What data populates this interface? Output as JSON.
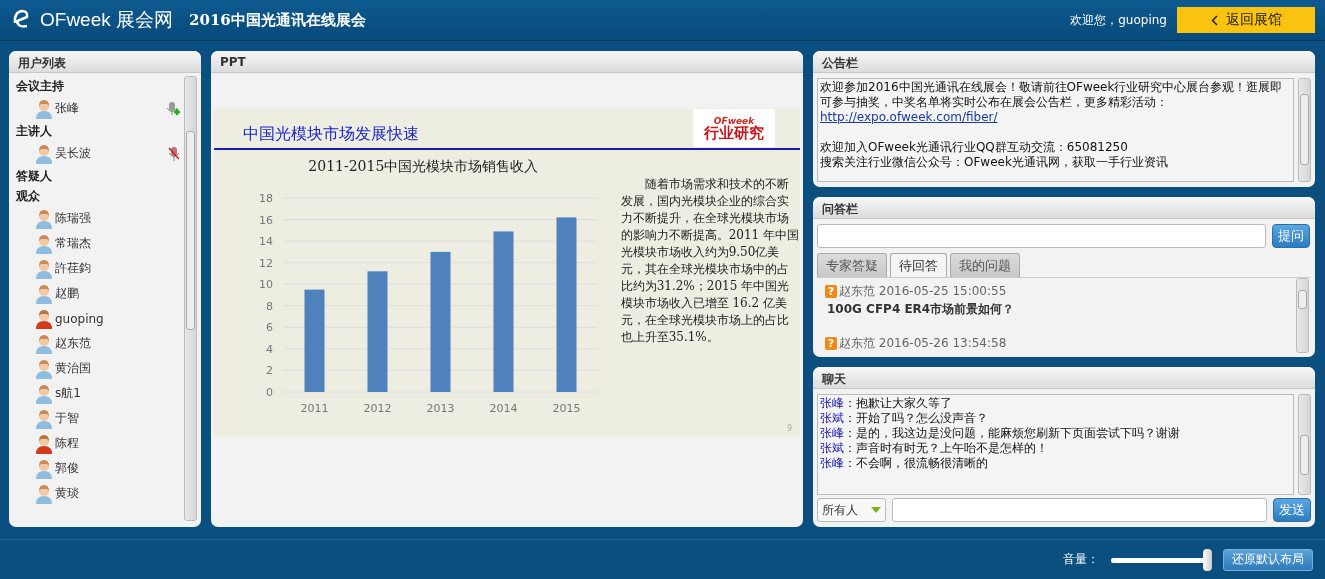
{
  "header": {
    "brand": "OFweek 展会网",
    "title": "2016中国光通讯在线展会",
    "welcome": "欢迎您，guoping",
    "back_button": "返回展馆"
  },
  "user_list": {
    "title": "用户列表",
    "groups": [
      {
        "name": "会议主持",
        "users": [
          {
            "name": "张峰",
            "kind": "blue",
            "mic": {
              "kind": "add"
            }
          }
        ]
      },
      {
        "name": "主讲人",
        "users": [
          {
            "name": "吴长波",
            "kind": "blue",
            "mic": {
              "kind": "muted"
            }
          }
        ]
      },
      {
        "name": "答疑人"
      },
      {
        "name": "观众",
        "users": [
          {
            "name": "陈瑞强",
            "kind": "blue"
          },
          {
            "name": "常瑞杰",
            "kind": "blue"
          },
          {
            "name": "許荏鈞",
            "kind": "blue"
          },
          {
            "name": "赵鹏",
            "kind": "blue"
          },
          {
            "name": "guoping",
            "kind": "red"
          },
          {
            "name": "赵东范",
            "kind": "blue"
          },
          {
            "name": "黄治国",
            "kind": "blue"
          },
          {
            "name": "s航1",
            "kind": "blue"
          },
          {
            "name": "于智",
            "kind": "blue"
          },
          {
            "name": "陈程",
            "kind": "red"
          },
          {
            "name": "郭俊",
            "kind": "blue"
          },
          {
            "name": "黄琰",
            "kind": "blue"
          }
        ]
      }
    ]
  },
  "ppt": {
    "title": "PPT",
    "slide": {
      "heading": "中国光模块市场发展快速",
      "logo_brand": "OFweek",
      "logo_text": "行业研究",
      "body": "随着市场需求和技术的不断发展，国内光模块企业的综合实力不断提升，在全球光模块市场的影响力不断提高。2011 年中国光模块市场收入约为9.50亿美元，其在全球光模块市场中的占比约为31.2%；2015 年中国光模块市场收入已增至 16.2 亿美元，在全球光模块市场上的占比也上升至35.1%。",
      "page_number": "9",
      "chart_data": {
        "type": "bar",
        "title": "2011-2015中国光模块市场销售收入",
        "categories": [
          "2011",
          "2012",
          "2013",
          "2014",
          "2015"
        ],
        "series": [
          {
            "color": "#4f81bd",
            "values": [
              9.5,
              11.2,
              13.0,
              14.9,
              16.2
            ]
          }
        ],
        "ylim": [
          0,
          18
        ],
        "grid": true,
        "yticks": [
          0,
          2,
          4,
          6,
          8,
          10,
          12,
          14,
          16,
          18
        ]
      }
    }
  },
  "announcement": {
    "title": "公告栏",
    "paragraphs": [
      {
        "items": [
          {
            "kind": "text",
            "text": "欢迎参加2016中国光通讯在线展会！敬请前往OFweek行业研究中心展台参观！逛展即可参与抽奖，中奖名单将实时公布在展会公告栏，更多精彩活动："
          },
          {
            "kind": "link",
            "text": "http://expo.ofweek.com/fiber/"
          }
        ]
      },
      {
        "items": [
          {
            "kind": "text",
            "text": "欢迎加入OFweek光通讯行业QQ群互动交流：65081250"
          },
          {
            "kind": "text",
            "text": "搜索关注行业微信公众号：OFweek光通讯网，获取一手行业资讯"
          }
        ]
      }
    ]
  },
  "qa": {
    "title": "问答栏",
    "ask_button": "提问",
    "tabs": [
      {
        "label": "专家答疑",
        "selected": false
      },
      {
        "label": "待回答",
        "selected": true
      },
      {
        "label": "我的问题",
        "selected": false
      }
    ],
    "questions": [
      {
        "badge": "?",
        "author": "赵东范",
        "time": "2016-05-25 15:00:55",
        "text": "100G CFP4 ER4市场前景如何？"
      },
      {
        "badge": "?",
        "author": "赵东范",
        "time": "2016-05-26 13:54:58"
      }
    ]
  },
  "chat": {
    "title": "聊天",
    "messages": [
      {
        "sender": "张峰",
        "separator": "：",
        "text": "抱歉让大家久等了"
      },
      {
        "sender": "张斌",
        "separator": "：",
        "text": "开始了吗？怎么没声音？"
      },
      {
        "sender": "张峰",
        "separator": "：",
        "text": "是的，我这边是没问题，能麻烦您刷新下页面尝试下吗？谢谢"
      },
      {
        "sender": "张斌",
        "separator": "：",
        "text": "声音时有时无？上午咍不是怎样的！"
      },
      {
        "sender": "张峰",
        "separator": "：",
        "text": "不会啊，很流畅很清晰的"
      }
    ],
    "recipient": "所有人",
    "send_button": "发送"
  },
  "footer": {
    "volume_label": "音量：",
    "volume": {
      "level": 0.97
    },
    "reset_button": "还原默认布局"
  }
}
